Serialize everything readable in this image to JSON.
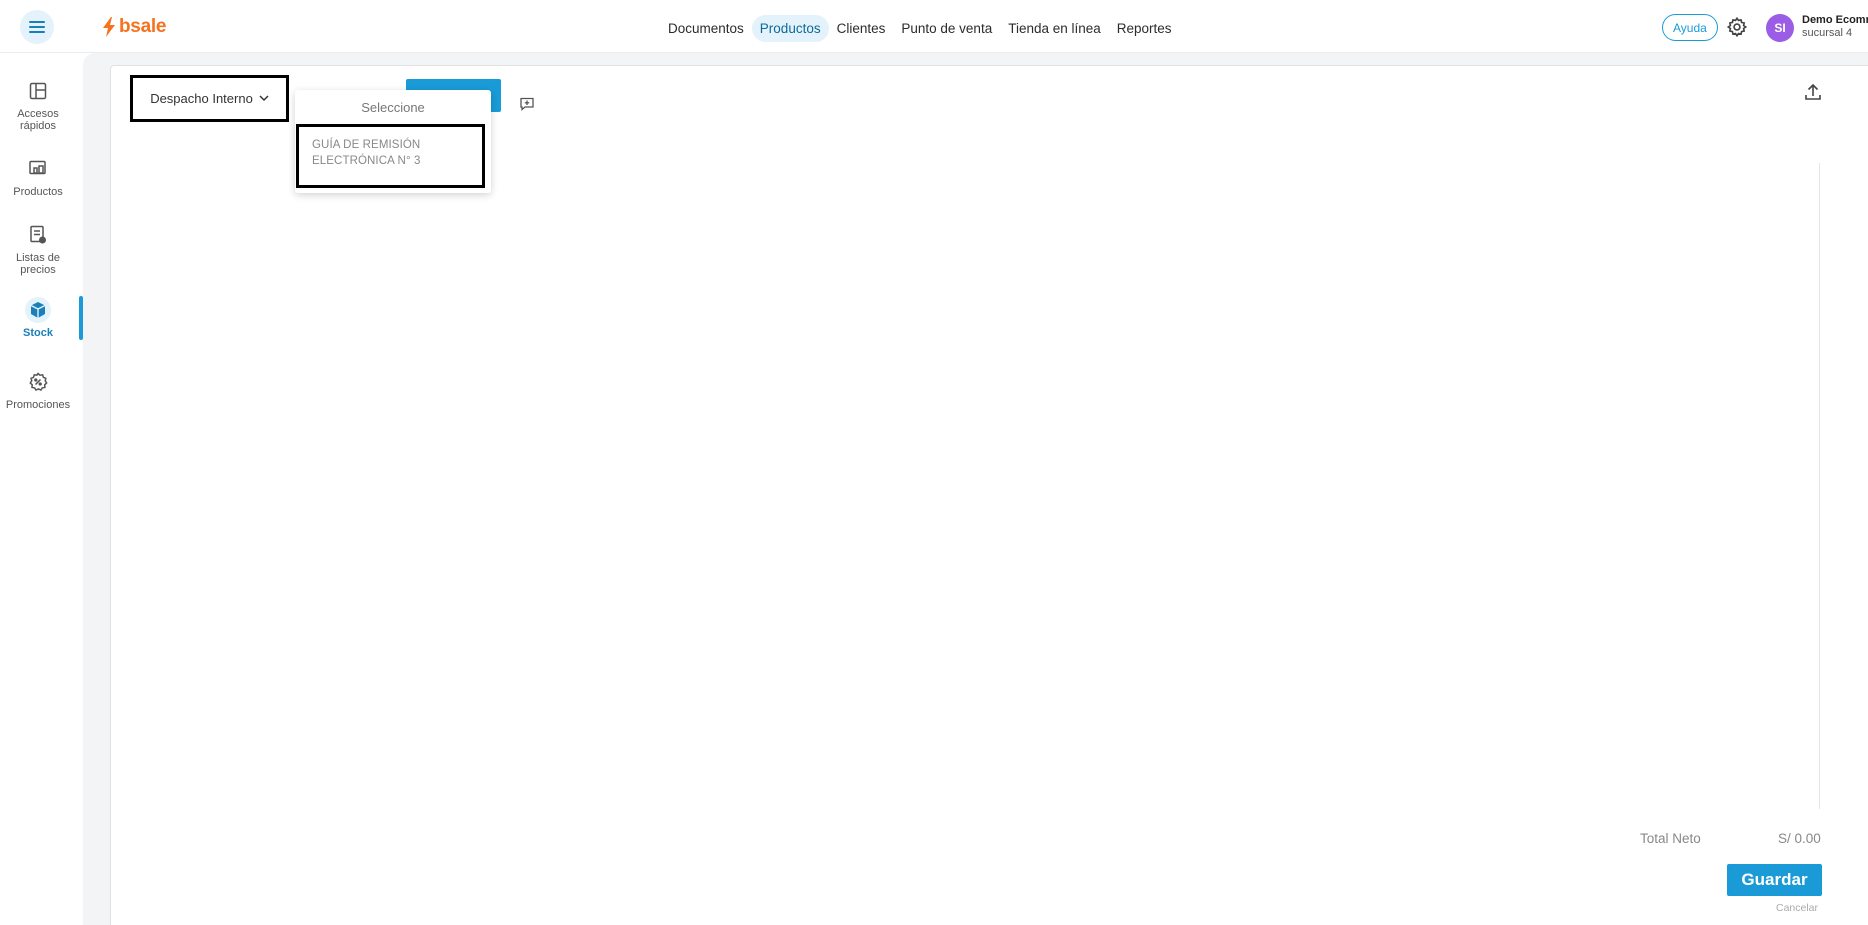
{
  "header": {
    "logo_text": "bsale",
    "nav": [
      {
        "label": "Documentos",
        "active": false
      },
      {
        "label": "Productos",
        "active": true
      },
      {
        "label": "Clientes",
        "active": false
      },
      {
        "label": "Punto de venta",
        "active": false
      },
      {
        "label": "Tienda en línea",
        "active": false
      },
      {
        "label": "Reportes",
        "active": false
      }
    ],
    "help_label": "Ayuda",
    "user": {
      "initials": "SI",
      "name": "Demo Ecomm",
      "branch": "sucursal 4"
    }
  },
  "sidebar": {
    "items": [
      {
        "label": "Accesos rápidos",
        "icon": "layout-icon",
        "active": false
      },
      {
        "label": "Productos",
        "icon": "products-icon",
        "active": false
      },
      {
        "label": "Listas de precios",
        "icon": "price-list-icon",
        "active": false
      },
      {
        "label": "Stock",
        "icon": "cube-icon",
        "active": true
      },
      {
        "label": "Promociones",
        "icon": "promotion-icon",
        "active": false
      }
    ]
  },
  "main": {
    "doc_type_label": "Despacho Interno",
    "dropdown": {
      "header": "Seleccione",
      "option": "GUÍA DE REMISIÓN ELECTRÓNICA N° 3"
    },
    "total_label": "Total Neto",
    "total_value": "S/ 0.00",
    "save_label": "Guardar",
    "cancel_label": "Cancelar"
  },
  "colors": {
    "accent": "#1a9bd7",
    "brand": "#f5731f",
    "avatar": "#9b5de5"
  }
}
